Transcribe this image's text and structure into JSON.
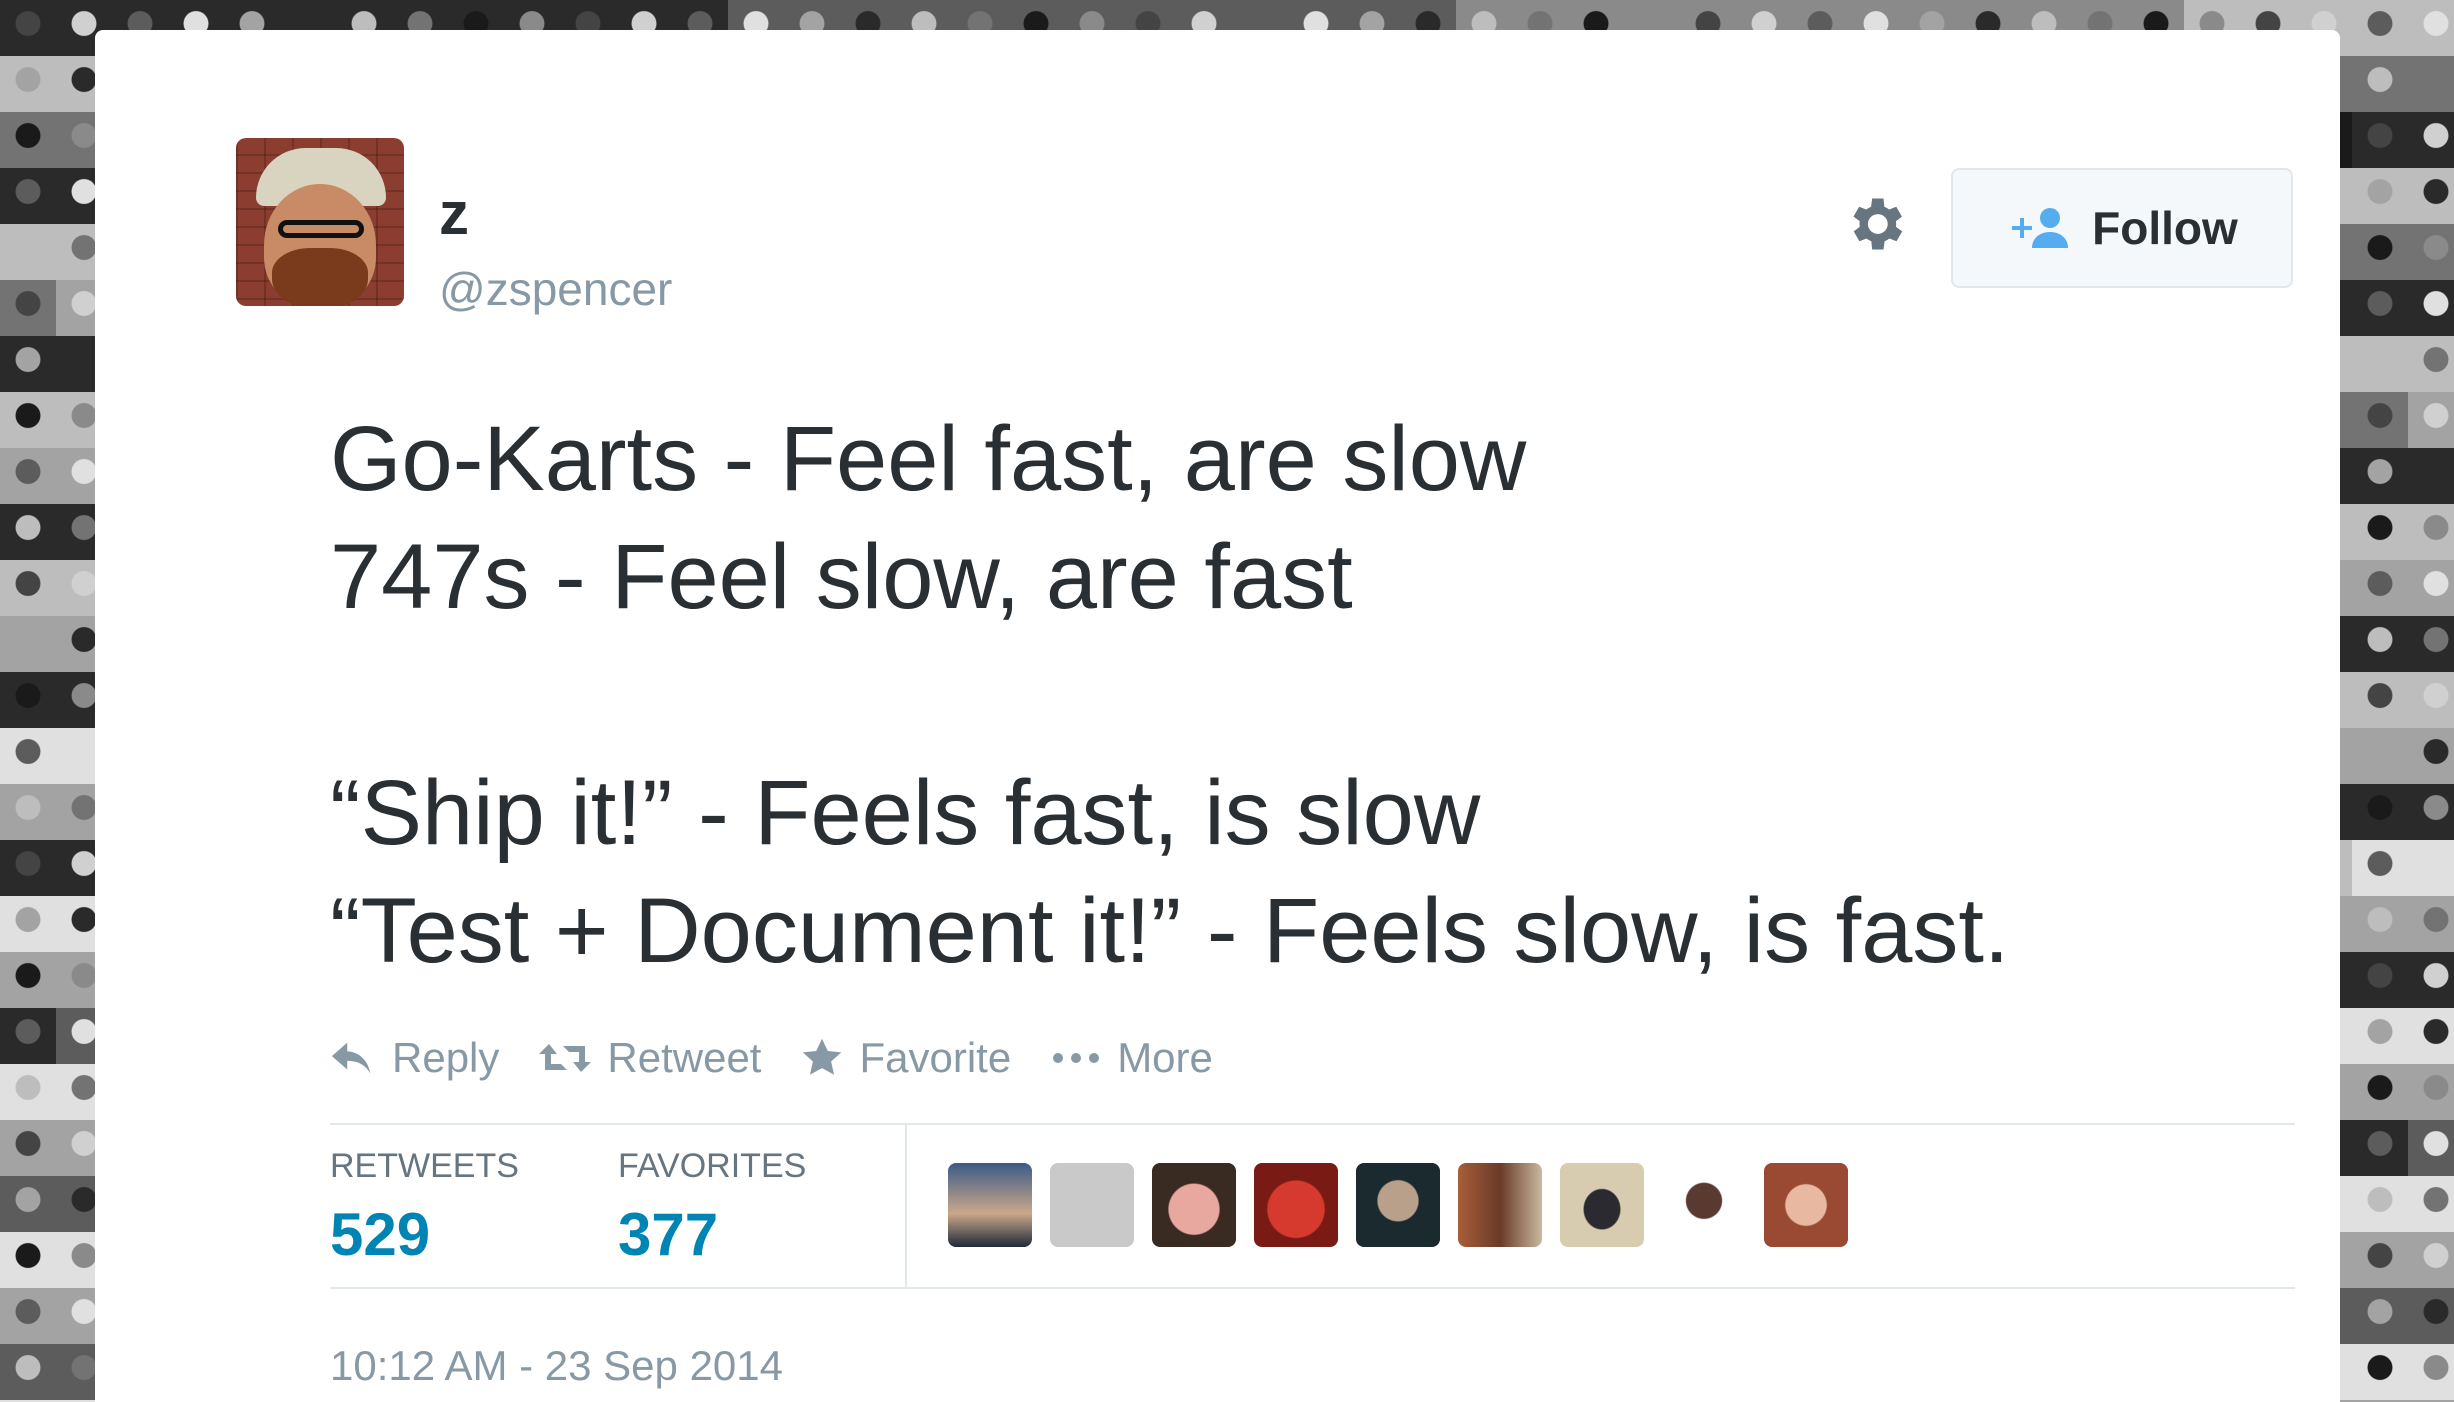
{
  "user": {
    "display_name": "z",
    "handle": "@zspencer"
  },
  "follow_button": {
    "label": "Follow"
  },
  "tweet": {
    "lines": [
      "Go-Karts - Feel fast, are slow",
      "747s - Feel slow, are fast",
      "",
      "“Ship it!” - Feels fast, is slow",
      "“Test + Document it!” - Feels slow, is fast."
    ],
    "timestamp": "10:12 AM - 23 Sep 2014"
  },
  "actions": {
    "reply": "Reply",
    "retweet": "Retweet",
    "favorite": "Favorite",
    "more": "More"
  },
  "stats": {
    "retweets_label": "RETWEETS",
    "retweets_value": "529",
    "favorites_label": "FAVORITES",
    "favorites_value": "377"
  },
  "colors": {
    "text": "#292f33",
    "muted": "#8899a6",
    "link_blue": "#0084b4",
    "follow_icon": "#55acee"
  }
}
